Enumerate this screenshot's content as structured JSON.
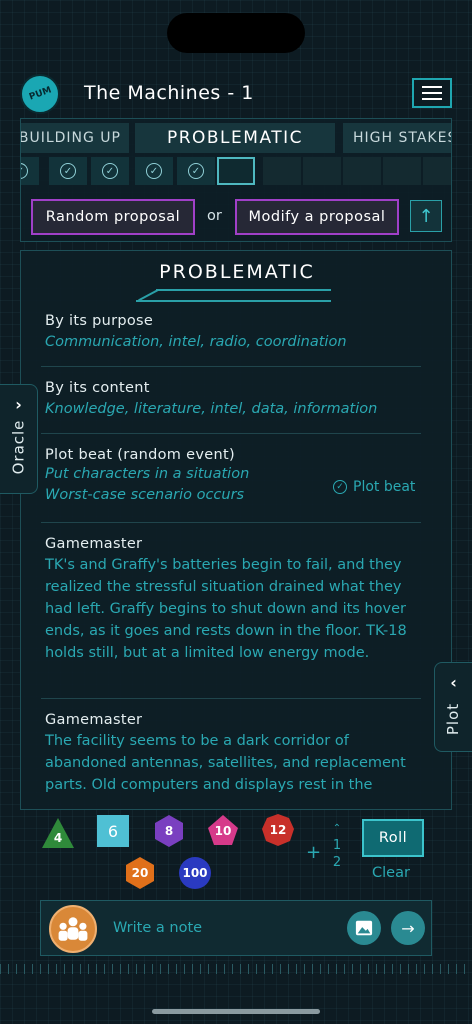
{
  "app": {
    "title": "The Machines - 1",
    "logo_text": "PUM"
  },
  "acts": {
    "items": [
      {
        "label": "BUILDING UP",
        "state": "past"
      },
      {
        "label": "PROBLEMATIC",
        "state": "active"
      },
      {
        "label": "HIGH STAKES",
        "state": "future"
      }
    ]
  },
  "proposals": {
    "random_label": "Random proposal",
    "or_label": "or",
    "modify_label": "Modify a proposal"
  },
  "scene": {
    "title": "PROBLEMATIC",
    "purpose": {
      "label": "By its purpose",
      "value": "Communication, intel, radio, coordination"
    },
    "content": {
      "label": "By its content",
      "value": "Knowledge, literature, intel, data, information"
    },
    "plot_beat": {
      "label": "Plot beat (random event)",
      "line1": "Put characters in a situation",
      "line2": "Worst-case scenario occurs",
      "tag": "Plot beat"
    },
    "gm1": {
      "label": "Gamemaster",
      "text": "TK's and Graffy's batteries begin to fail, and they realized the stressful situation drained what they had left. Graffy begins to shut down and its hover ends, as it goes and rests down in the floor. TK-18 holds still, but at a limited low energy mode."
    },
    "gm2": {
      "label": "Gamemaster",
      "text": "The facility seems to be a dark corridor of abandoned antennas, satellites, and replacement parts. Old computers and displays rest in the"
    }
  },
  "side_tabs": {
    "oracle": "Oracle",
    "plot": "Plot"
  },
  "dice": {
    "d4": "4",
    "d6": "6",
    "d8": "8",
    "d10": "10",
    "d12": "12",
    "d20": "20",
    "d100": "100",
    "plus": "+",
    "modifier_values": [
      "1",
      "2"
    ],
    "roll_label": "Roll",
    "clear_label": "Clear"
  },
  "note": {
    "placeholder": "Write a note"
  },
  "colors": {
    "accent": "#2aa8b2",
    "proposal_border": "#a040c8",
    "d4": "#2f8a3a",
    "d6": "#4fc0d4",
    "d8": "#7a3fc0",
    "d10": "#d63a8a",
    "d12": "#c8302a",
    "d20": "#e0701a",
    "d100": "#2a3ac0"
  }
}
